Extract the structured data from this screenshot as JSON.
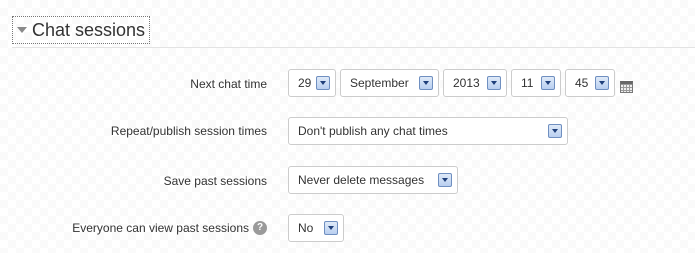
{
  "section": {
    "title": "Chat sessions"
  },
  "fields": {
    "next_chat_time": {
      "label": "Next chat time",
      "day": "29",
      "month": "September",
      "year": "2013",
      "hour": "11",
      "minute": "45"
    },
    "repeat_publish": {
      "label": "Repeat/publish session times",
      "value": "Don't publish any chat times"
    },
    "save_past_sessions": {
      "label": "Save past sessions",
      "value": "Never delete messages"
    },
    "everyone_can_view": {
      "label": "Everyone can view past sessions",
      "value": "No",
      "help_icon_glyph": "?"
    }
  }
}
